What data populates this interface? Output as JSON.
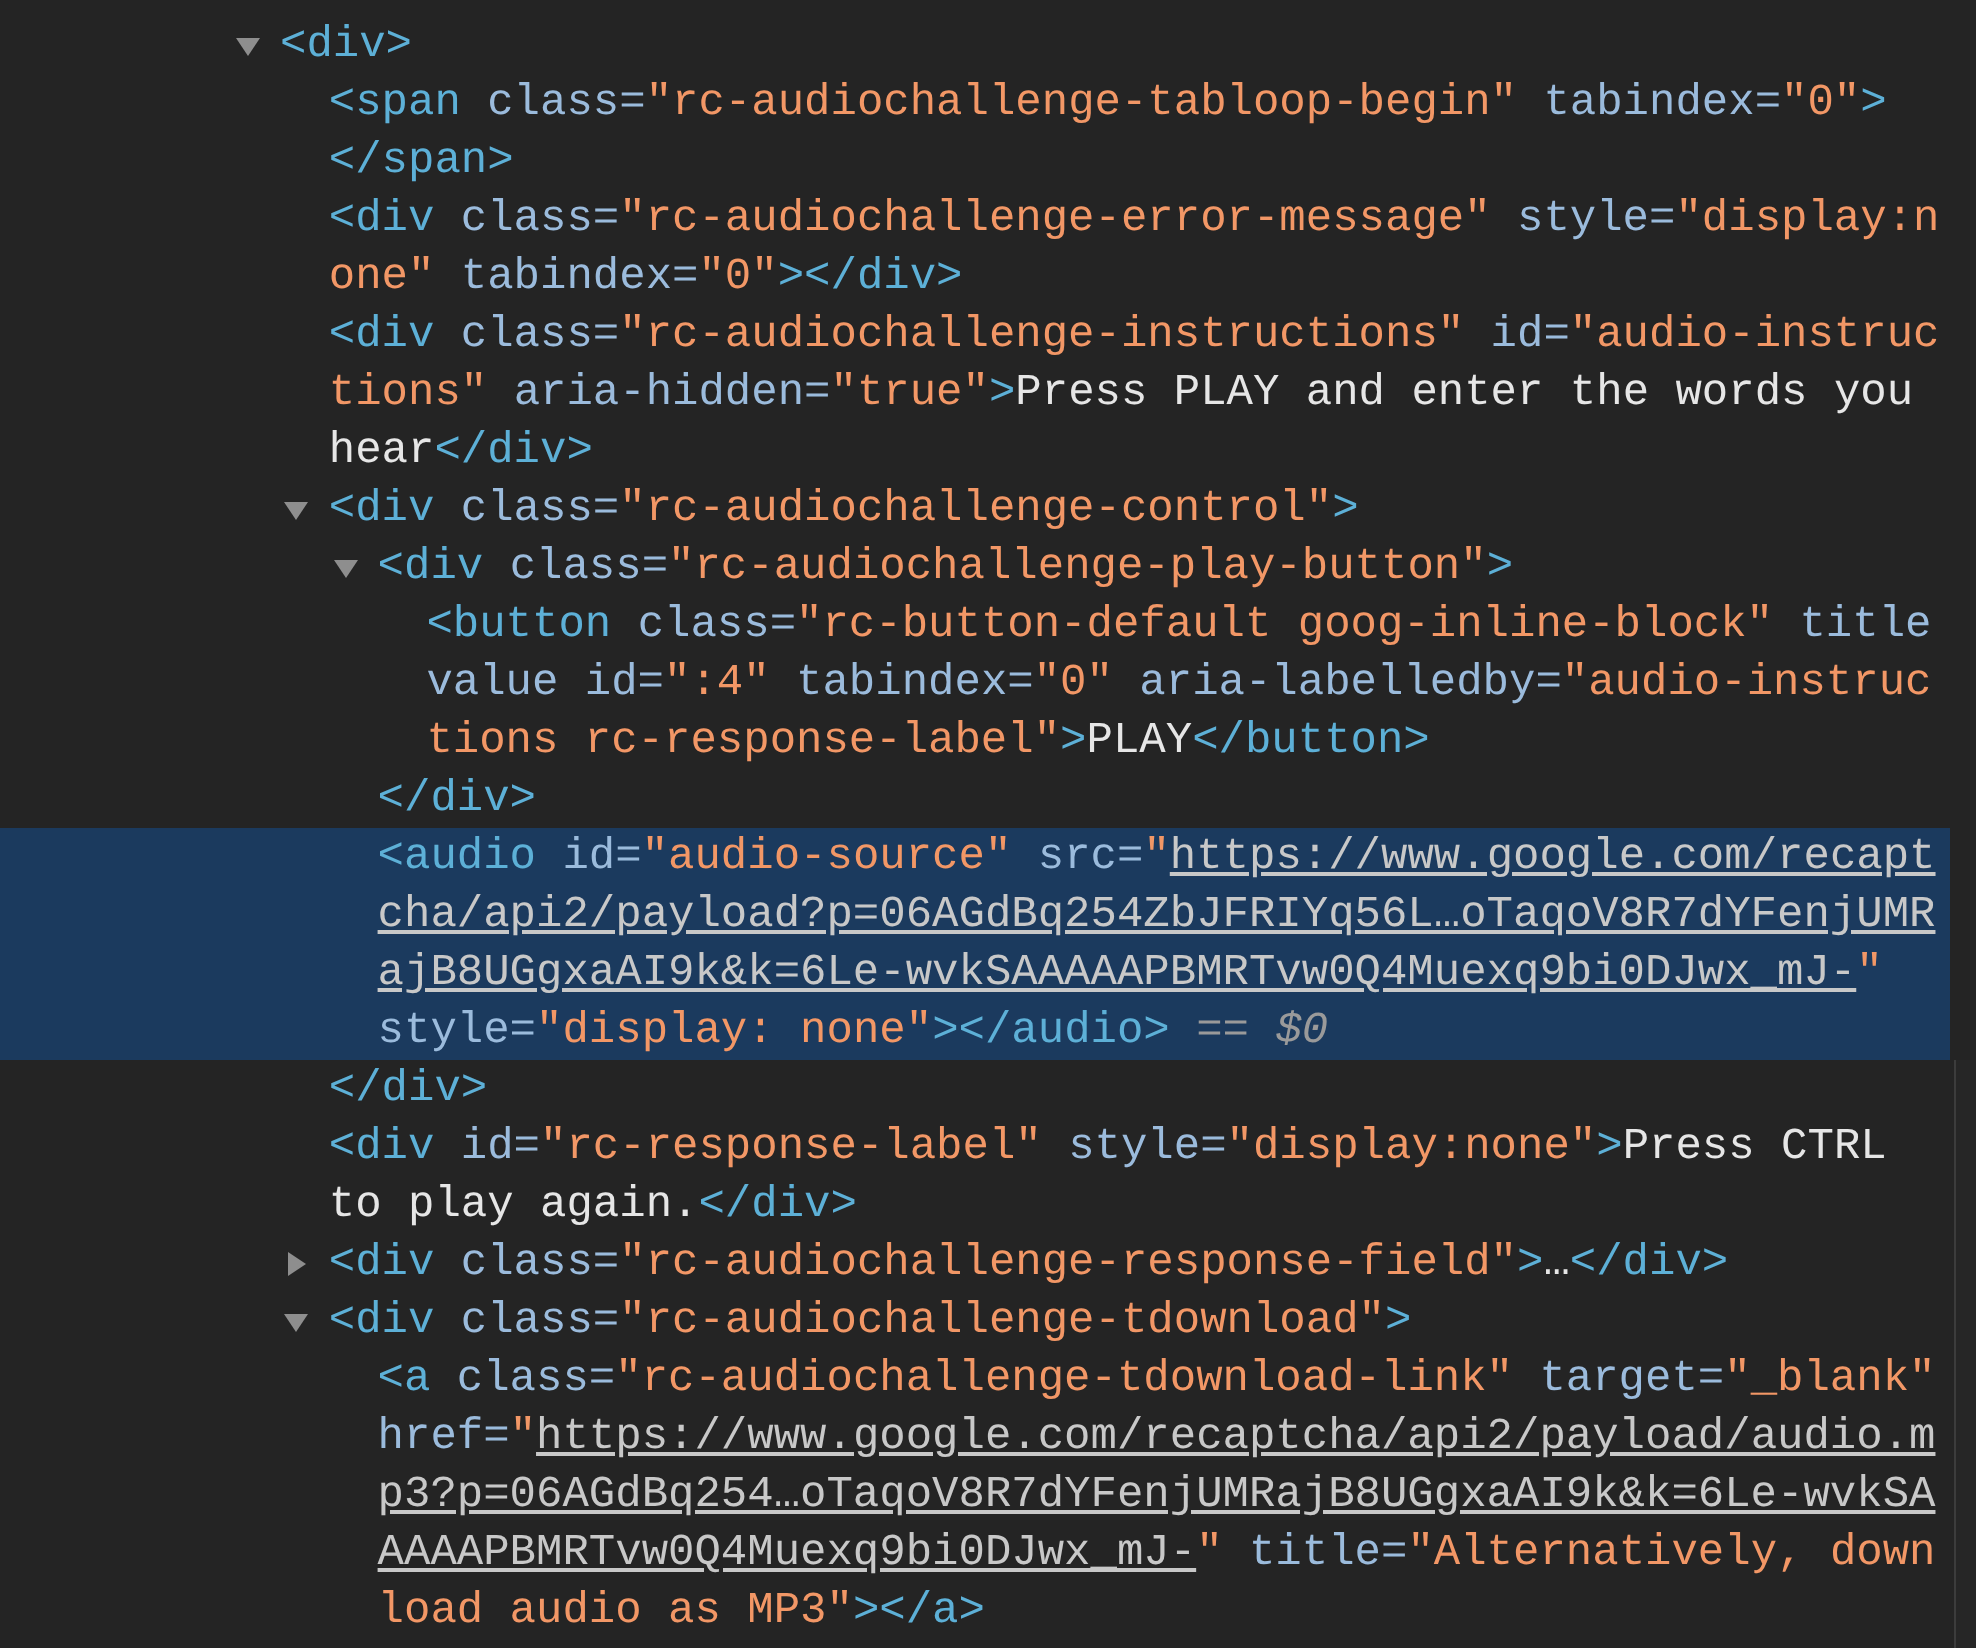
{
  "nodes": [
    {
      "selected": false,
      "expanded": true,
      "tokens": [
        {
          "kind": "tag",
          "text": "<div>"
        }
      ],
      "children": [
        {
          "selected": false,
          "tokens": [
            {
              "kind": "tag",
              "text": "<span"
            },
            {
              "kind": "attr",
              "text": " class="
            },
            {
              "kind": "value",
              "text": "\"rc-audiochallenge-tabloop-begin\""
            },
            {
              "kind": "attr",
              "text": " tabindex="
            },
            {
              "kind": "value",
              "text": "\"0\""
            },
            {
              "kind": "tag",
              "text": ">"
            },
            {
              "kind": "close",
              "text": "</span>"
            }
          ]
        },
        {
          "selected": false,
          "tokens": [
            {
              "kind": "tag",
              "text": "<div"
            },
            {
              "kind": "attr",
              "text": " class="
            },
            {
              "kind": "value",
              "text": "\"rc-audiochallenge-error-message\""
            },
            {
              "kind": "attr",
              "text": " style="
            },
            {
              "kind": "value",
              "text": "\"display:none\""
            },
            {
              "kind": "attr",
              "text": " tabindex="
            },
            {
              "kind": "value",
              "text": "\"0\""
            },
            {
              "kind": "tag",
              "text": ">"
            },
            {
              "kind": "close",
              "text": "</div>"
            }
          ]
        },
        {
          "selected": false,
          "tokens": [
            {
              "kind": "tag",
              "text": "<div"
            },
            {
              "kind": "attr",
              "text": " class="
            },
            {
              "kind": "value",
              "text": "\"rc-audiochallenge-instructions\""
            },
            {
              "kind": "attr",
              "text": " id="
            },
            {
              "kind": "value",
              "text": "\"audio-instructions\""
            },
            {
              "kind": "attr",
              "text": " aria-hidden="
            },
            {
              "kind": "value",
              "text": "\"true\""
            },
            {
              "kind": "tag",
              "text": ">"
            },
            {
              "kind": "text",
              "text": "Press PLAY and enter the words you hear"
            },
            {
              "kind": "close",
              "text": "</div>"
            }
          ]
        },
        {
          "selected": false,
          "expanded": true,
          "tokens": [
            {
              "kind": "tag",
              "text": "<div"
            },
            {
              "kind": "attr",
              "text": " class="
            },
            {
              "kind": "value",
              "text": "\"rc-audiochallenge-control\""
            },
            {
              "kind": "tag",
              "text": ">"
            }
          ],
          "children": [
            {
              "selected": false,
              "expanded": true,
              "tokens": [
                {
                  "kind": "tag",
                  "text": "<div"
                },
                {
                  "kind": "attr",
                  "text": " class="
                },
                {
                  "kind": "value",
                  "text": "\"rc-audiochallenge-play-button\""
                },
                {
                  "kind": "tag",
                  "text": ">"
                }
              ],
              "children": [
                {
                  "selected": false,
                  "tokens": [
                    {
                      "kind": "tag",
                      "text": "<button"
                    },
                    {
                      "kind": "attr",
                      "text": " class="
                    },
                    {
                      "kind": "value",
                      "text": "\"rc-button-default goog-inline-block\""
                    },
                    {
                      "kind": "attr",
                      "text": " title"
                    },
                    {
                      "kind": "attr",
                      "text": " value"
                    },
                    {
                      "kind": "attr",
                      "text": " id="
                    },
                    {
                      "kind": "value",
                      "text": "\":4\""
                    },
                    {
                      "kind": "attr",
                      "text": " tabindex="
                    },
                    {
                      "kind": "value",
                      "text": "\"0\""
                    },
                    {
                      "kind": "attr",
                      "text": " aria-labelledby="
                    },
                    {
                      "kind": "value",
                      "text": "\"audio-instructions rc-response-label\""
                    },
                    {
                      "kind": "tag",
                      "text": ">"
                    },
                    {
                      "kind": "text",
                      "text": "PLAY"
                    },
                    {
                      "kind": "close",
                      "text": "</button>"
                    }
                  ]
                }
              ]
            },
            {
              "selected": false,
              "tokens": [
                {
                  "kind": "close",
                  "text": "</div>"
                }
              ]
            },
            {
              "selected": true,
              "tokens": [
                {
                  "kind": "tag",
                  "text": "<audio"
                },
                {
                  "kind": "attr",
                  "text": " id="
                },
                {
                  "kind": "value",
                  "text": "\"audio-source\""
                },
                {
                  "kind": "attr",
                  "text": " src="
                },
                {
                  "kind": "value",
                  "text": "\""
                },
                {
                  "kind": "link",
                  "text": "https://www.google.com/recaptcha/api2/payload?p=06AGdBq254ZbJFRIYq56L…oTaqoV8R7dYFenjUMRajB8UGgxaAI9k&k=6Le-wvkSAAAAAPBMRTvw0Q4Muexq9bi0DJwx_mJ-"
                },
                {
                  "kind": "value",
                  "text": "\""
                },
                {
                  "kind": "attr",
                  "text": " style="
                },
                {
                  "kind": "value",
                  "text": "\"display: none\""
                },
                {
                  "kind": "tag",
                  "text": ">"
                },
                {
                  "kind": "close",
                  "text": "</audio>"
                },
                {
                  "kind": "ref",
                  "text": " == $0"
                }
              ]
            }
          ]
        },
        {
          "selected": false,
          "tokens": [
            {
              "kind": "close",
              "text": "</div>"
            }
          ]
        },
        {
          "selected": false,
          "tokens": [
            {
              "kind": "tag",
              "text": "<div"
            },
            {
              "kind": "attr",
              "text": " id="
            },
            {
              "kind": "value",
              "text": "\"rc-response-label\""
            },
            {
              "kind": "attr",
              "text": " style="
            },
            {
              "kind": "value",
              "text": "\"display:none\""
            },
            {
              "kind": "tag",
              "text": ">"
            },
            {
              "kind": "text",
              "text": "Press CTRL to play again."
            },
            {
              "kind": "close",
              "text": "</div>"
            }
          ]
        },
        {
          "selected": false,
          "expanded": false,
          "tokens": [
            {
              "kind": "tag",
              "text": "<div"
            },
            {
              "kind": "attr",
              "text": " class="
            },
            {
              "kind": "value",
              "text": "\"rc-audiochallenge-response-field\""
            },
            {
              "kind": "tag",
              "text": ">"
            },
            {
              "kind": "text",
              "text": "…"
            },
            {
              "kind": "close",
              "text": "</div>"
            }
          ]
        },
        {
          "selected": false,
          "expanded": true,
          "tokens": [
            {
              "kind": "tag",
              "text": "<div"
            },
            {
              "kind": "attr",
              "text": " class="
            },
            {
              "kind": "value",
              "text": "\"rc-audiochallenge-tdownload\""
            },
            {
              "kind": "tag",
              "text": ">"
            }
          ],
          "children": [
            {
              "selected": false,
              "tokens": [
                {
                  "kind": "tag",
                  "text": "<a"
                },
                {
                  "kind": "attr",
                  "text": " class="
                },
                {
                  "kind": "value",
                  "text": "\"rc-audiochallenge-tdownload-link\""
                },
                {
                  "kind": "attr",
                  "text": " target="
                },
                {
                  "kind": "value",
                  "text": "\"_blank\""
                },
                {
                  "kind": "attr",
                  "text": " href="
                },
                {
                  "kind": "value",
                  "text": "\""
                },
                {
                  "kind": "link",
                  "text": "https://www.google.com/recaptcha/api2/payload/audio.mp3?p=06AGdBq254…oTaqoV8R7dYFenjUMRajB8UGgxaAI9k&k=6Le-wvkSAAAAAPBMRTvw0Q4Muexq9bi0DJwx_mJ-"
                },
                {
                  "kind": "value",
                  "text": "\""
                },
                {
                  "kind": "attr",
                  "text": " title="
                },
                {
                  "kind": "value",
                  "text": "\"Alternatively, download audio as MP3\""
                },
                {
                  "kind": "tag",
                  "text": ">"
                },
                {
                  "kind": "close",
                  "text": "</a>"
                }
              ]
            }
          ]
        }
      ]
    }
  ]
}
